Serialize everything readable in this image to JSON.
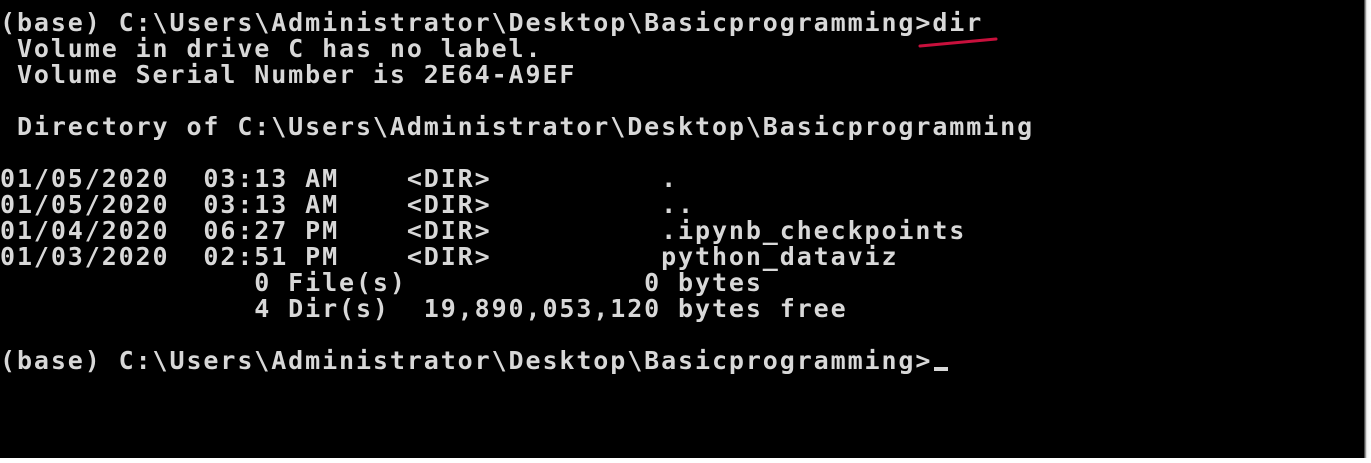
{
  "console": {
    "lines": [
      "(base) C:\\Users\\Administrator\\Desktop\\Basicprogramming>dir",
      " Volume in drive C has no label.",
      " Volume Serial Number is 2E64-A9EF",
      "",
      " Directory of C:\\Users\\Administrator\\Desktop\\Basicprogramming",
      "",
      "01/05/2020  03:13 AM    <DIR>          .",
      "01/05/2020  03:13 AM    <DIR>          ..",
      "01/04/2020  06:27 PM    <DIR>          .ipynb_checkpoints",
      "01/03/2020  02:51 PM    <DIR>          python_dataviz",
      "               0 File(s)              0 bytes",
      "               4 Dir(s)  19,890,053,120 bytes free",
      "",
      "(base) C:\\Users\\Administrator\\Desktop\\Basicprogramming>"
    ]
  },
  "colors": {
    "background": "#000000",
    "text": "#d8d8d8",
    "annotation": "#c8103c"
  }
}
